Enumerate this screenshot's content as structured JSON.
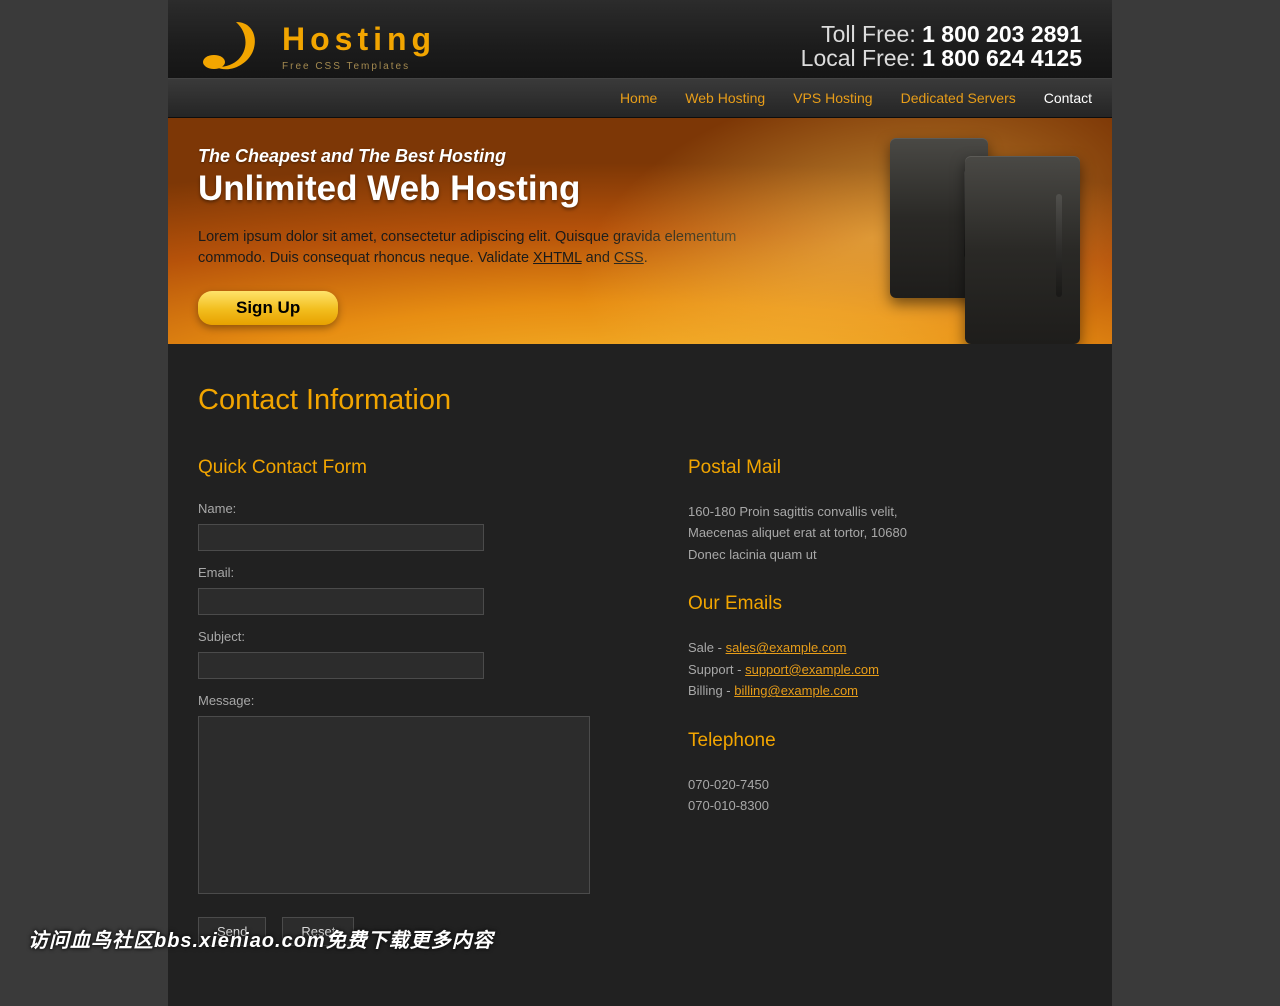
{
  "brand": {
    "name": "Hosting",
    "tagline": "Free CSS Templates"
  },
  "phones": {
    "toll_label": "Toll Free:",
    "toll_num": "1 800 203 2891",
    "local_label": "Local Free:",
    "local_num": "1 800 624 4125"
  },
  "nav": {
    "items": [
      {
        "label": "Home",
        "current": false
      },
      {
        "label": "Web Hosting",
        "current": false
      },
      {
        "label": "VPS Hosting",
        "current": false
      },
      {
        "label": "Dedicated Servers",
        "current": false
      },
      {
        "label": "Contact",
        "current": true
      }
    ]
  },
  "hero": {
    "kicker": "The Cheapest and The Best Hosting",
    "heading": "Unlimited Web Hosting",
    "body_pre": "Lorem ipsum dolor sit amet, consectetur adipiscing elit. Quisque gravida elementum commodo. Duis consequat rhoncus neque. Validate ",
    "link_xhtml": "XHTML",
    "mid": " and ",
    "link_css": "CSS",
    "tail": ".",
    "signup": "Sign Up"
  },
  "page_title": "Contact Information",
  "form": {
    "heading": "Quick Contact Form",
    "name_label": "Name:",
    "email_label": "Email:",
    "subject_label": "Subject:",
    "message_label": "Message:",
    "send": "Send",
    "reset": "Reset"
  },
  "postal": {
    "heading": "Postal Mail",
    "l1": "160-180 Proin sagittis convallis velit,",
    "l2": "Maecenas aliquet erat at tortor, 10680",
    "l3": "Donec lacinia quam ut"
  },
  "emails": {
    "heading": "Our Emails",
    "rows": [
      {
        "prefix": "Sale - ",
        "email": "sales@example.com"
      },
      {
        "prefix": "Support - ",
        "email": "support@example.com"
      },
      {
        "prefix": "Billing - ",
        "email": "billing@example.com"
      }
    ]
  },
  "tel": {
    "heading": "Telephone",
    "l1": "070-020-7450",
    "l2": "070-010-8300"
  },
  "watermark": "访问血鸟社区bbs.xieniao.com免费下载更多内容"
}
